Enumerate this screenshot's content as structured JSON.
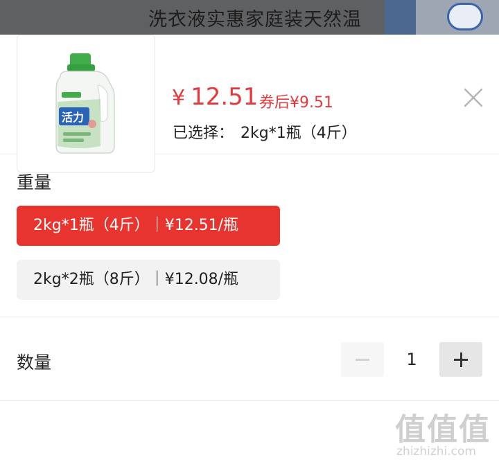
{
  "background": {
    "title_text": "洗衣液实惠家庭装天然温"
  },
  "product": {
    "image_icon": "laundry-detergent-bottle",
    "price_symbol": "¥",
    "price": "12.51",
    "coupon_price": "券后¥9.51",
    "selected_label": "已选择：",
    "selected_value": "2kg*1瓶（4斤）"
  },
  "close_icon": "close-icon",
  "weight": {
    "label": "重量",
    "options": [
      {
        "label": "2kg*1瓶（4斤）｜¥12.51/瓶",
        "selected": true
      },
      {
        "label": "2kg*2瓶（8斤）｜¥12.08/瓶",
        "selected": false
      }
    ]
  },
  "quantity": {
    "label": "数量",
    "value": "1",
    "minus_icon": "minus-icon",
    "plus_icon": "plus-icon"
  },
  "watermark": {
    "logo": "值值值",
    "url": "zhizhizhi.com"
  },
  "colors": {
    "accent": "#e4393c",
    "selected_option_bg": "#e8342e",
    "option_bg": "#f2f2f2"
  }
}
